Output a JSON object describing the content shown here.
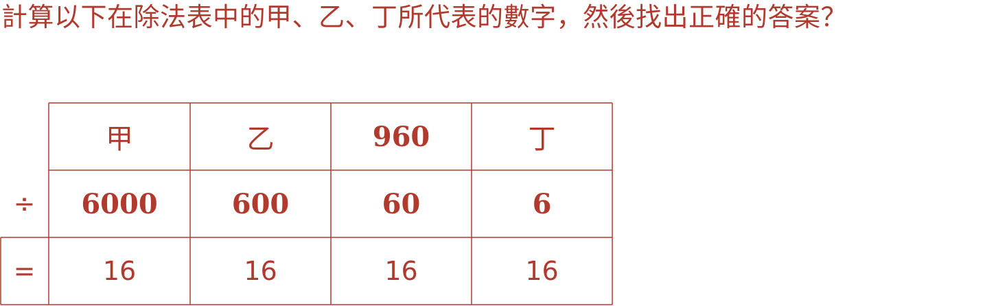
{
  "colors": {
    "accent": "#b03a2e",
    "line": "#b03a2e"
  },
  "question": "計算以下在除法表中的甲、乙、丁所代表的數字，然後找出正確的答案？",
  "table": {
    "dividend_row": [
      "甲",
      "乙",
      "960",
      "丁"
    ],
    "divide_symbol": "÷",
    "divisor_row": [
      "6000",
      "600",
      "60",
      "6"
    ],
    "equals_symbol": "=",
    "quotient_row": [
      "16",
      "16",
      "16",
      "16"
    ]
  }
}
